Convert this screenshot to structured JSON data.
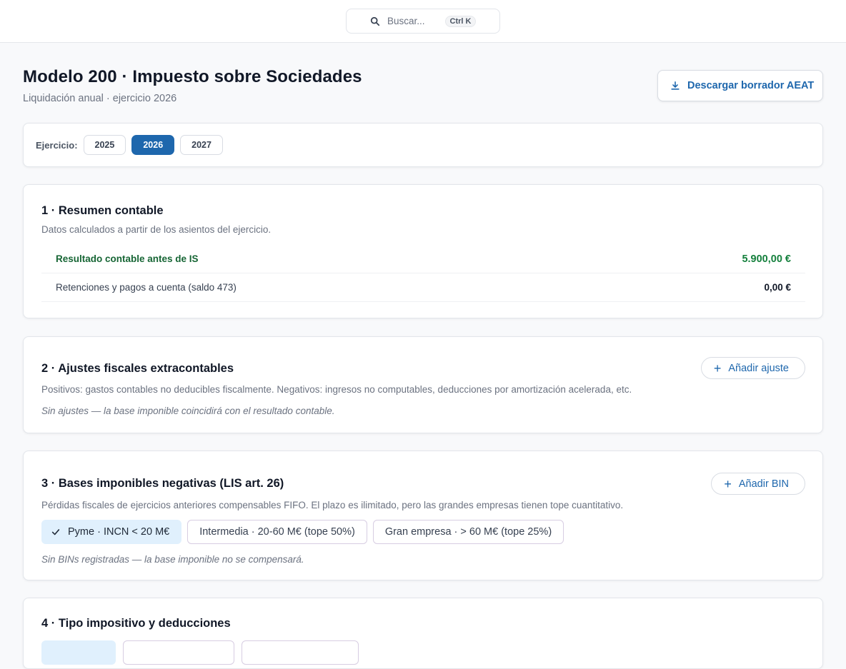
{
  "search": {
    "placeholder": "Buscar...",
    "shortcut": "Ctrl K",
    "icon": "search-icon"
  },
  "header": {
    "title": "Modelo 200 · Impuesto sobre Sociedades",
    "subtitle": "Liquidación anual · ejercicio 2026",
    "download_label": "Descargar borrador AEAT"
  },
  "year_selector": {
    "label": "Ejercicio:",
    "years": [
      "2025",
      "2026",
      "2027"
    ],
    "selected": "2026"
  },
  "section1": {
    "title": "1 · Resumen contable",
    "desc": "Datos calculados a partir de los asientos del ejercicio.",
    "rows": [
      {
        "label": "Resultado contable antes de IS",
        "value": "5.900,00 €"
      },
      {
        "label": "Retenciones y pagos a cuenta (saldo 473)",
        "value": "0,00 €"
      }
    ]
  },
  "section2": {
    "title": "2 · Ajustes fiscales extracontables",
    "add_label": "Añadir ajuste",
    "desc": "Positivos: gastos contables no deducibles fiscalmente. Negativos: ingresos no computables, deducciones por amortización acelerada, etc.",
    "empty_note": "Sin ajustes — la base imponible coincidirá con el resultado contable."
  },
  "section3": {
    "title": "3 · Bases imponibles negativas (LIS art. 26)",
    "add_label": "Añadir BIN",
    "desc": "Pérdidas fiscales de ejercicios anteriores compensables FIFO. El plazo es ilimitado, pero las grandes empresas tienen tope cuantitativo.",
    "sizes": [
      "Pyme · INCN < 20 M€",
      "Intermedia · 20-60 M€ (tope 50%)",
      "Gran empresa · > 60 M€ (tope 25%)"
    ],
    "selected_index": 0,
    "empty_note": "Sin BINs registradas — la base imponible no se compensará."
  },
  "section4": {
    "title": "4 · Tipo impositivo y deducciones"
  },
  "colors": {
    "accent": "#1e67ad",
    "positive": "#15803d",
    "selected_chip": "#e0f0fd"
  }
}
